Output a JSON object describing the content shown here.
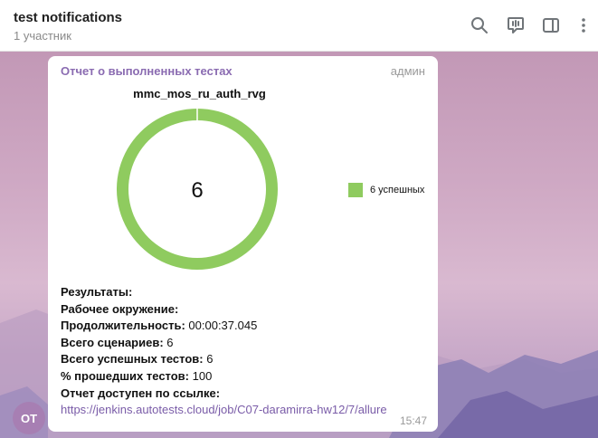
{
  "header": {
    "title": "test notifications",
    "subtitle": "1 участник",
    "icons": [
      "search-icon",
      "voice-chat-icon",
      "sidebar-toggle-icon",
      "more-icon"
    ]
  },
  "avatar": {
    "initials": "OT",
    "color": "#a77fb3"
  },
  "message": {
    "sender": "Отчет о выполненных тестах",
    "role": "админ",
    "time": "15:47",
    "chart_title": "mmc_mos_ru_auth_rvg",
    "center_value": "6",
    "legend_label": "6 успешных",
    "details": {
      "results_label": "Результаты:",
      "env_label": "Рабочее окружение:",
      "duration_label": "Продолжительность:",
      "duration_value": "00:00:37.045",
      "scenarios_label": "Всего сценариев:",
      "scenarios_value": "6",
      "passed_label": "Всего успешных тестов:",
      "passed_value": "6",
      "percent_label": "% прошедших тестов:",
      "percent_value": "100",
      "report_label": "Отчет доступен по ссылке:",
      "report_link": "https://jenkins.autotests.cloud/job/C07-daramirra-hw12/7/allure"
    }
  },
  "chart_data": {
    "type": "pie",
    "title": "mmc_mos_ru_auth_rvg",
    "categories": [
      "6 успешных"
    ],
    "values": [
      6
    ],
    "colors": [
      "#8fcb5f"
    ],
    "center_label": "6",
    "legend": "right"
  },
  "colors": {
    "accent": "#8a6bb1",
    "link": "#7a5ca8",
    "success": "#8fcb5f"
  }
}
